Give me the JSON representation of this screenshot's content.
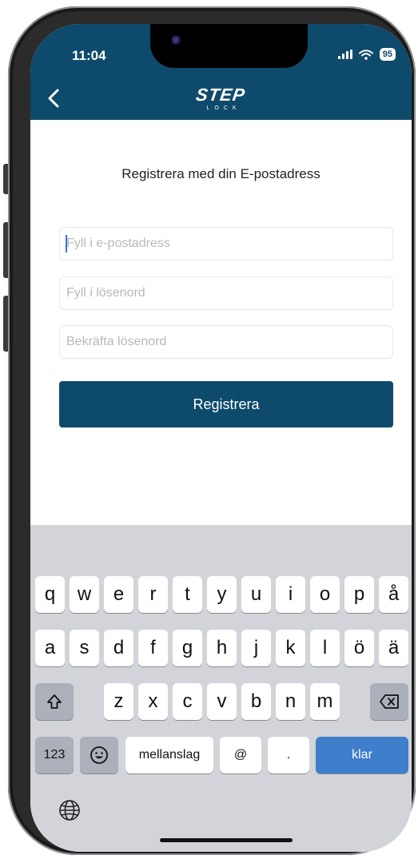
{
  "status_bar": {
    "time": "11:04",
    "battery": "95"
  },
  "header": {
    "logo_main": "STEP",
    "logo_sub": "LOCK"
  },
  "form": {
    "heading": "Registrera med din E-postadress",
    "email_placeholder": "Fyll i e-postadress",
    "password_placeholder": "Fyll i lösenord",
    "confirm_placeholder": "Bekräfta lösenord",
    "register_label": "Registrera"
  },
  "keyboard": {
    "row1": [
      "q",
      "w",
      "e",
      "r",
      "t",
      "y",
      "u",
      "i",
      "o",
      "p",
      "å"
    ],
    "row2": [
      "a",
      "s",
      "d",
      "f",
      "g",
      "h",
      "j",
      "k",
      "l",
      "ö",
      "ä"
    ],
    "row3": [
      "z",
      "x",
      "c",
      "v",
      "b",
      "n",
      "m"
    ],
    "numbers_label": "123",
    "space_label": "mellanslag",
    "at_label": "@",
    "dot_label": ".",
    "return_label": "klar"
  },
  "colors": {
    "brand": "#0e4a6b",
    "return_key": "#3f7ecb",
    "keyboard_bg": "#d2d4d9"
  },
  "icons": [
    "back-chevron-icon",
    "signal-icon",
    "wifi-icon",
    "shift-icon",
    "backspace-icon",
    "emoji-icon",
    "globe-icon"
  ]
}
